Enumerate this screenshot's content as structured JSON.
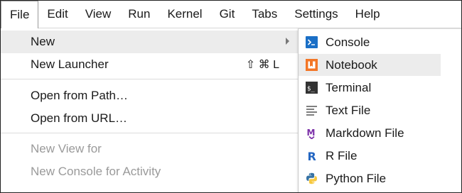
{
  "menubar": {
    "items": [
      {
        "label": "File"
      },
      {
        "label": "Edit"
      },
      {
        "label": "View"
      },
      {
        "label": "Run"
      },
      {
        "label": "Kernel"
      },
      {
        "label": "Git"
      },
      {
        "label": "Tabs"
      },
      {
        "label": "Settings"
      },
      {
        "label": "Help"
      }
    ]
  },
  "file_menu": {
    "new": "New",
    "new_launcher": "New Launcher",
    "new_launcher_shortcut": "⇧ ⌘ L",
    "open_from_path": "Open from Path…",
    "open_from_url": "Open from URL…",
    "new_view_for": "New View for",
    "new_console_for_activity": "New Console for Activity"
  },
  "new_submenu": {
    "items": [
      {
        "label": "Console",
        "icon": "console-icon"
      },
      {
        "label": "Notebook",
        "icon": "notebook-icon"
      },
      {
        "label": "Terminal",
        "icon": "terminal-icon"
      },
      {
        "label": "Text File",
        "icon": "text-file-icon"
      },
      {
        "label": "Markdown File",
        "icon": "markdown-icon"
      },
      {
        "label": "R File",
        "icon": "r-file-icon"
      },
      {
        "label": "Python File",
        "icon": "python-icon"
      }
    ],
    "icons": {
      "terminal_glyph": "$_",
      "markdown_glyph": "M",
      "r_glyph": "R"
    }
  },
  "colors": {
    "console_blue": "#1a6fc6",
    "notebook_orange": "#f37626",
    "terminal_dark": "#333333",
    "markdown_purple": "#7b2fa8",
    "r_blue": "#2466c2",
    "python_blue": "#3672a4",
    "python_yellow": "#f7c940",
    "highlight": "#ececec"
  }
}
